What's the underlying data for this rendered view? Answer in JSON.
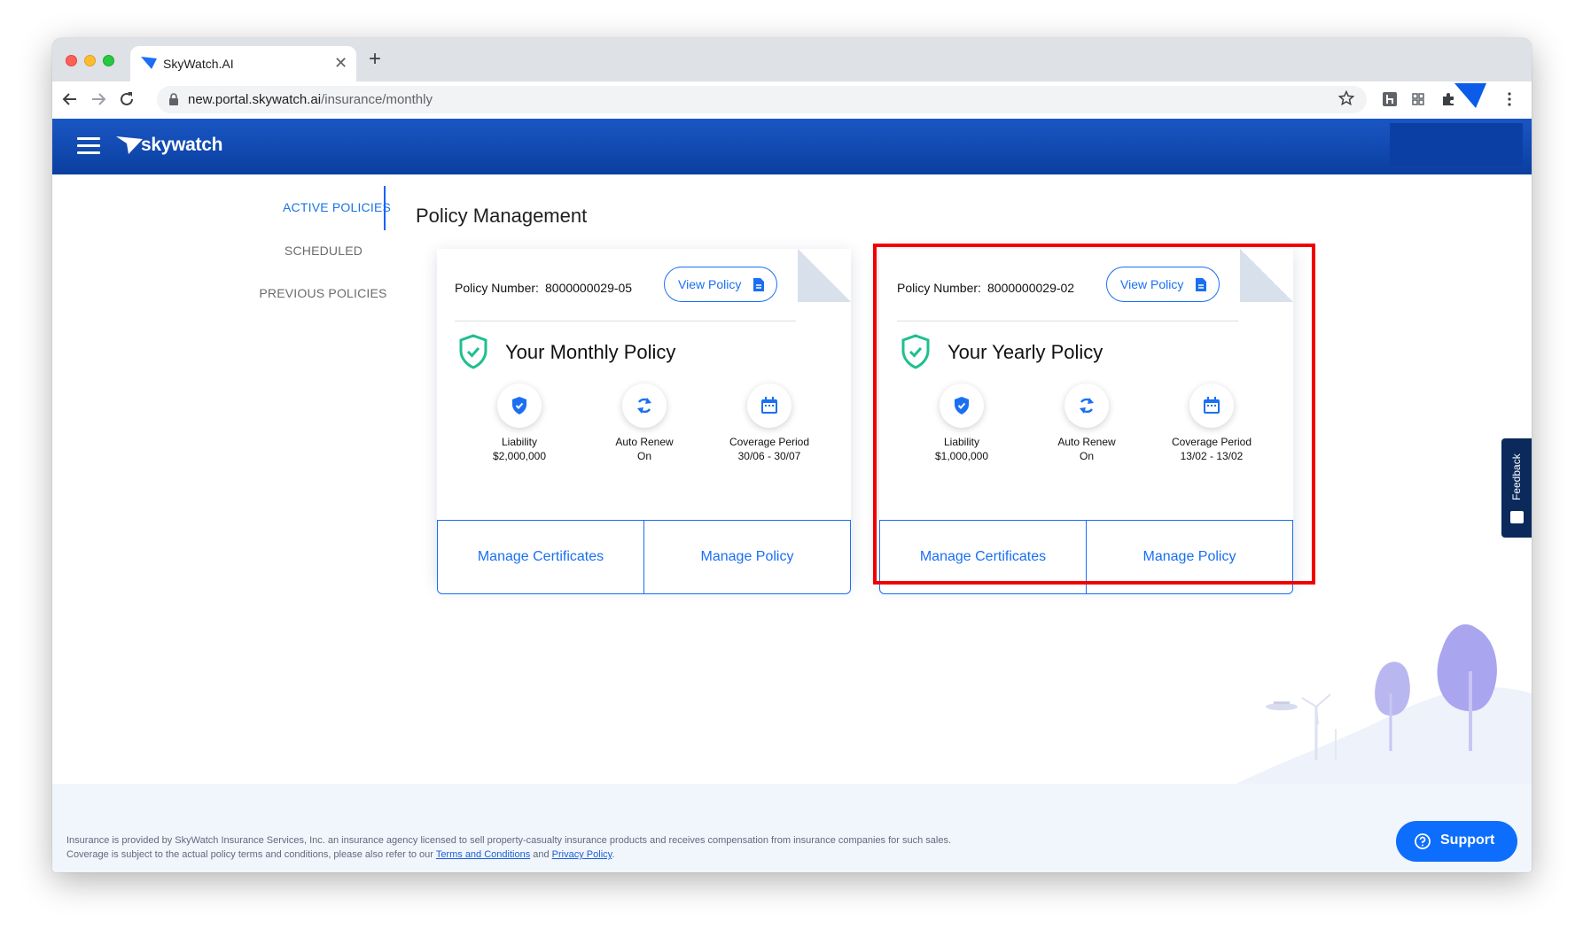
{
  "browser": {
    "tab_title": "SkyWatch.AI",
    "new_tab": "+",
    "url_host": "new.portal.skywatch.ai",
    "url_path": "/insurance/monthly"
  },
  "app": {
    "logo_text": "skywatch"
  },
  "sidenav": {
    "items": [
      {
        "label": "ACTIVE POLICIES",
        "active": true
      },
      {
        "label": "SCHEDULED",
        "active": false
      },
      {
        "label": "PREVIOUS POLICIES",
        "active": false
      }
    ]
  },
  "page": {
    "title": "Policy Management"
  },
  "policies": [
    {
      "number_label": "Policy Number:",
      "number": "8000000029-05",
      "view_label": "View Policy",
      "heading": "Your Monthly Policy",
      "features": [
        {
          "name": "Liability",
          "value": "$2,000,000",
          "icon": "shield-check-icon"
        },
        {
          "name": "Auto Renew",
          "value": "On",
          "icon": "sync-icon"
        },
        {
          "name": "Coverage Period",
          "value": "30/06 - 30/07",
          "icon": "calendar-icon"
        }
      ],
      "manage_certs_label": "Manage Certificates",
      "manage_policy_label": "Manage Policy"
    },
    {
      "number_label": "Policy Number:",
      "number": "8000000029-02",
      "view_label": "View Policy",
      "heading": "Your Yearly Policy",
      "features": [
        {
          "name": "Liability",
          "value": "$1,000,000",
          "icon": "shield-check-icon"
        },
        {
          "name": "Auto Renew",
          "value": "On",
          "icon": "sync-icon"
        },
        {
          "name": "Coverage Period",
          "value": "13/02 - 13/02",
          "icon": "calendar-icon"
        }
      ],
      "manage_certs_label": "Manage Certificates",
      "manage_policy_label": "Manage Policy"
    }
  ],
  "feedback": {
    "label": "Feedback"
  },
  "footer": {
    "text_1": "Insurance is provided by SkyWatch Insurance Services, Inc. an insurance agency licensed to sell property-casualty insurance products and receives compensation from insurance companies for such sales. Coverage is subject to the actual policy terms and conditions, please also refer to our ",
    "terms_link": "Terms and Conditions",
    "text_2": " and ",
    "privacy_link": "Privacy Policy",
    "text_3": "."
  },
  "support": {
    "label": "Support"
  },
  "colors": {
    "accent": "#1a6ff2",
    "header": "#0a3f9f",
    "highlight": "#f20000",
    "shield": "#1fbf8f"
  }
}
